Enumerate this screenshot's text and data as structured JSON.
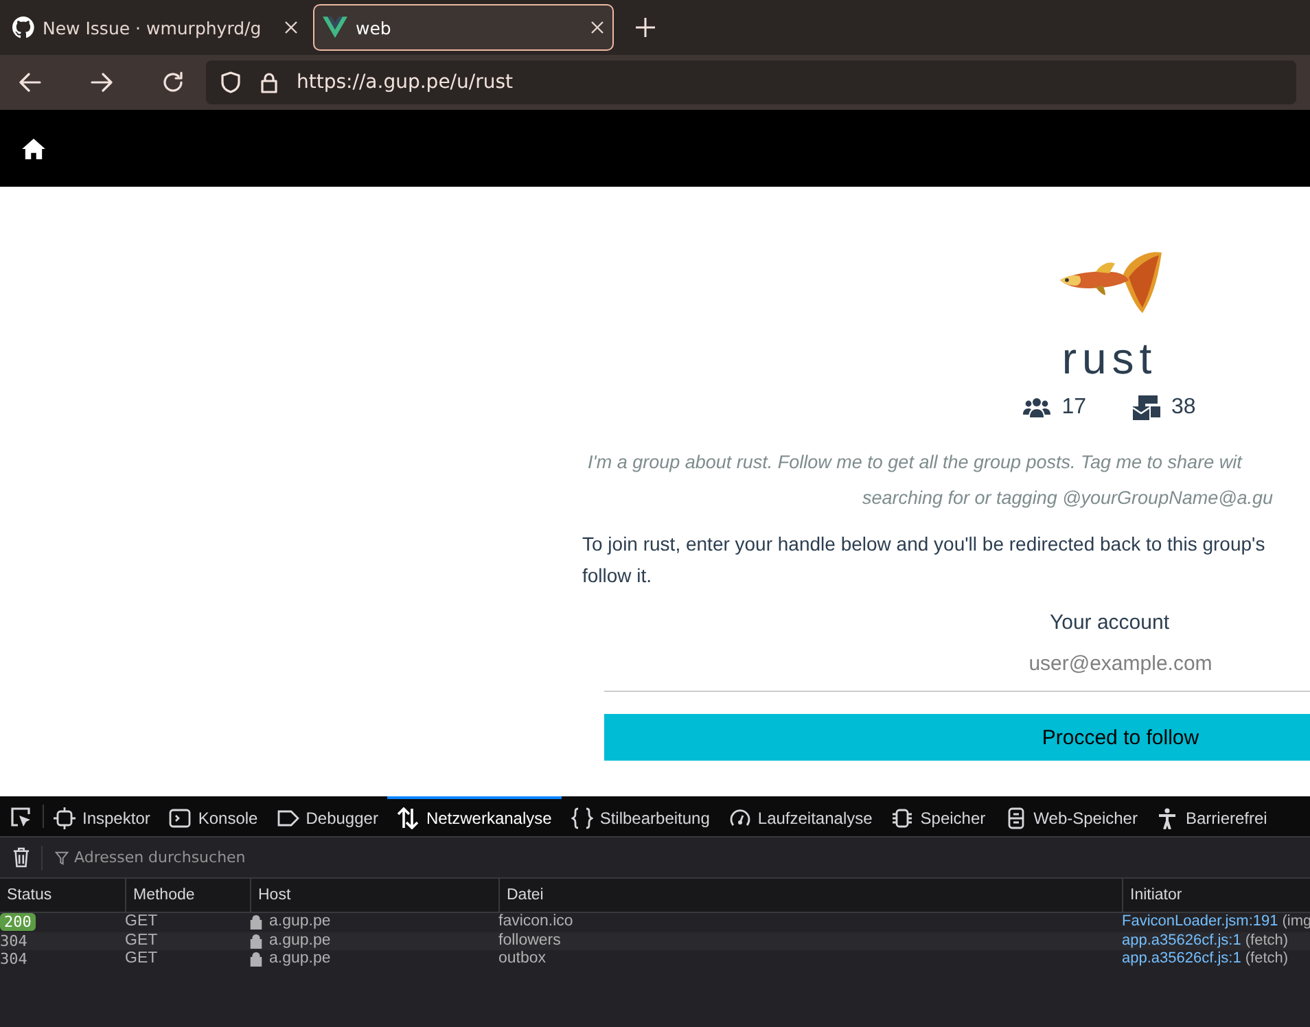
{
  "browser": {
    "tabs": [
      {
        "kind": "github",
        "title": "New Issue · wmurphyrd/g",
        "selected": false
      },
      {
        "kind": "vue",
        "title": "web",
        "selected": true
      }
    ],
    "url": "https://a.gup.pe/u/rust"
  },
  "page": {
    "group_name": "rust",
    "stats": [
      {
        "kind": "followers",
        "count": "17"
      },
      {
        "kind": "posts",
        "count": "38"
      }
    ],
    "description_lines": [
      "I'm a group about rust. Follow me to get all the group posts. Tag me to share wit",
      "searching for or tagging @yourGroupName@a.gu"
    ],
    "join_text_lines": [
      "To join rust, enter your handle below and you'll be redirected back to this group's",
      "follow it."
    ],
    "account_label": "Your account",
    "account_field": {
      "placeholder": "user@example.com"
    },
    "follow_button": "Procced to follow"
  },
  "devtools": {
    "tools": [
      {
        "kind": "inspector",
        "label": "Inspektor",
        "selected": false
      },
      {
        "kind": "console",
        "label": "Konsole",
        "selected": false
      },
      {
        "kind": "debugger",
        "label": "Debugger",
        "selected": false
      },
      {
        "kind": "network",
        "label": "Netzwerkanalyse",
        "selected": true
      },
      {
        "kind": "style",
        "label": "Stilbearbeitung",
        "selected": false
      },
      {
        "kind": "performance",
        "label": "Laufzeitanalyse",
        "selected": false
      },
      {
        "kind": "memory",
        "label": "Speicher",
        "selected": false
      },
      {
        "kind": "storage",
        "label": "Web-Speicher",
        "selected": false
      },
      {
        "kind": "accessibility",
        "label": "Barrierefrei",
        "selected": false
      }
    ],
    "filter": {
      "placeholder": "Adressen durchsuchen"
    },
    "columns": [
      "Status",
      "Methode",
      "Host",
      "Datei",
      "Initiator"
    ],
    "rows": [
      {
        "status": "200",
        "kind": "ok",
        "method": "GET",
        "host": "a.gup.pe",
        "file": "favicon.ico",
        "initiator": "FaviconLoader.jsm:191",
        "initiator_note": "(img"
      },
      {
        "status": "304",
        "kind": "cached",
        "method": "GET",
        "host": "a.gup.pe",
        "file": "followers",
        "initiator": "app.a35626cf.js:1",
        "initiator_note": "(fetch)"
      },
      {
        "status": "304",
        "kind": "cached",
        "method": "GET",
        "host": "a.gup.pe",
        "file": "outbox",
        "initiator": "app.a35626cf.js:1",
        "initiator_note": "(fetch)"
      }
    ]
  }
}
